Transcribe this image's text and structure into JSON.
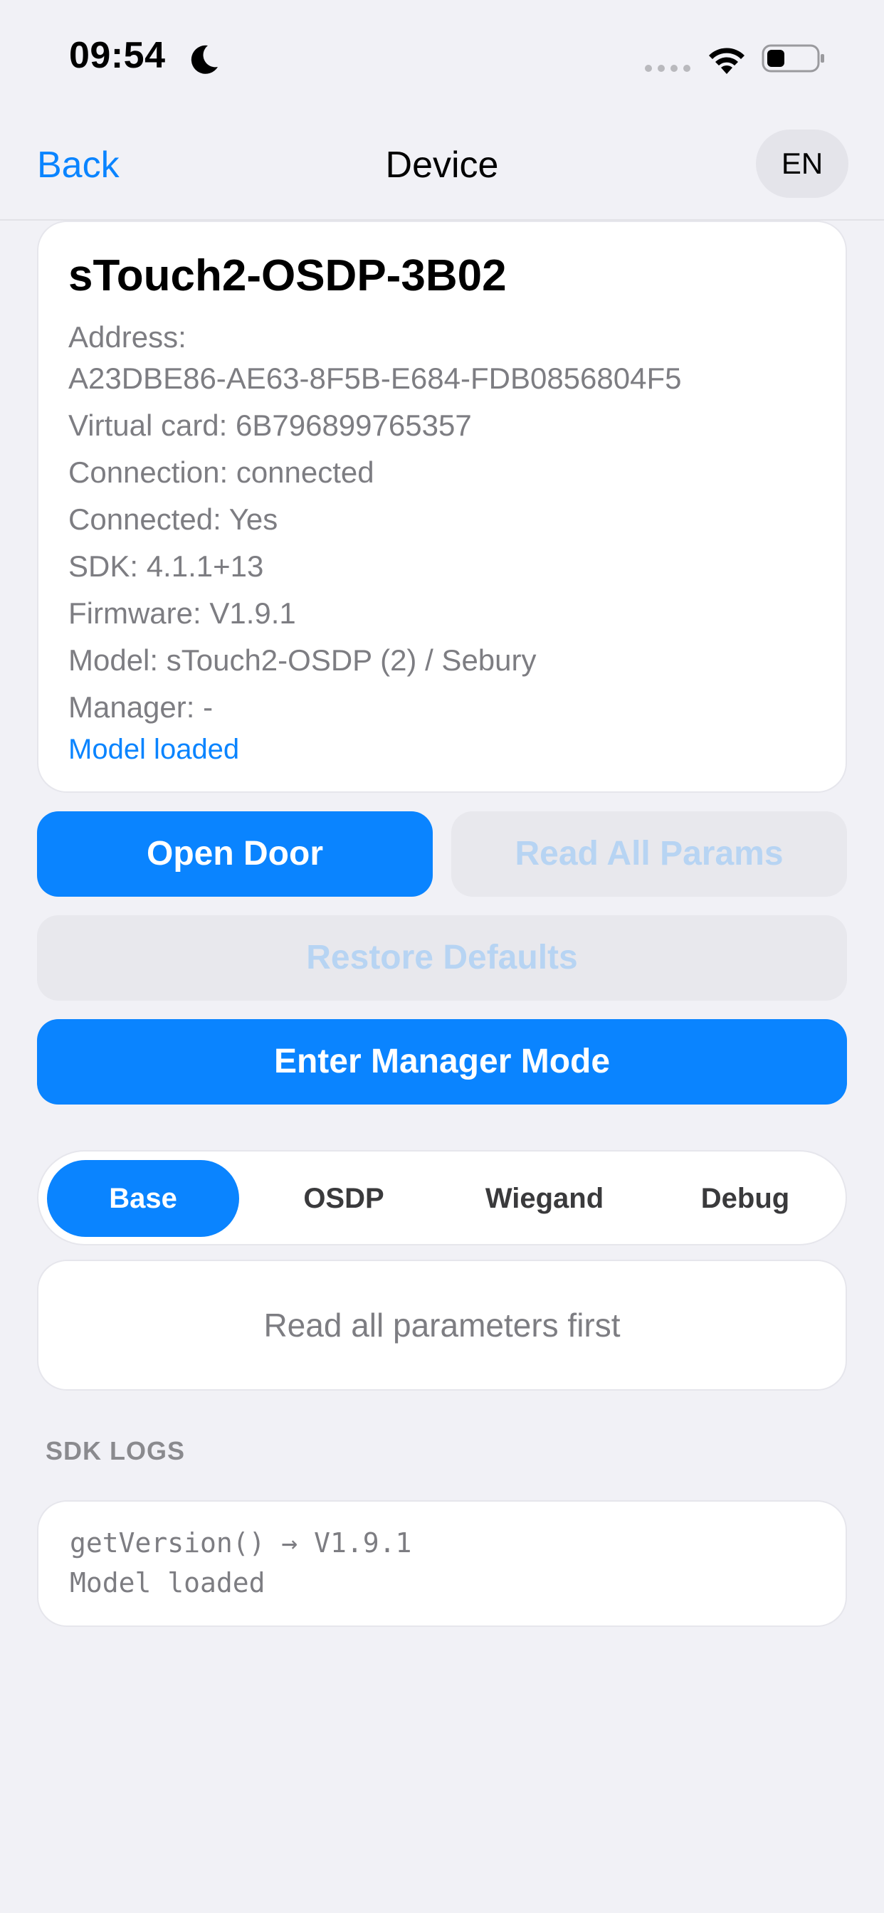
{
  "status_bar": {
    "time": "09:54"
  },
  "nav": {
    "back_label": "Back",
    "title": "Device",
    "language": "EN"
  },
  "device": {
    "name": "sTouch2-OSDP-3B02",
    "address_label": "Address:",
    "address_value": "A23DBE86-AE63-8F5B-E684-FDB0856804F5",
    "virtual_card": "Virtual card: 6B796899765357",
    "connection": "Connection: connected",
    "connected": "Connected: Yes",
    "sdk": "SDK: 4.1.1+13",
    "firmware": "Firmware: V1.9.1",
    "model": "Model: sTouch2-OSDP (2) / Sebury",
    "manager": "Manager: -",
    "model_status": "Model loaded"
  },
  "actions": {
    "open_door": "Open Door",
    "read_all_params": "Read All Params",
    "restore_defaults": "Restore Defaults",
    "enter_manager_mode": "Enter Manager Mode"
  },
  "tabs": [
    {
      "label": "Base",
      "active": true
    },
    {
      "label": "OSDP",
      "active": false
    },
    {
      "label": "Wiegand",
      "active": false
    },
    {
      "label": "Debug",
      "active": false
    }
  ],
  "params_placeholder": "Read all parameters first",
  "logs": {
    "header": "SDK LOGS",
    "lines": [
      "getVersion() → V1.9.1",
      "Model loaded"
    ]
  },
  "colors": {
    "accent": "#0a84ff",
    "background": "#f1f1f6",
    "secondary_text": "#7d7d82"
  }
}
